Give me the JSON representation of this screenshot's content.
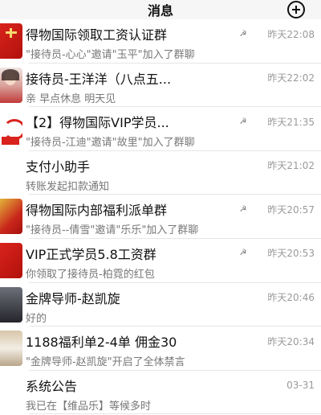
{
  "header": {
    "title": "消息",
    "add_icon": "plus-circle-icon"
  },
  "mute_glyph": "☭",
  "chats": [
    {
      "name": "得物国际领取工资认证群",
      "preview": "\"接待员-心心\"邀请\"玉平\"加入了群聊",
      "time": "昨天22:08",
      "muted": true,
      "avatar": "av-red av-cross"
    },
    {
      "name": "接待员-王洋洋（八点五...",
      "preview": "亲 早点休息  明天见",
      "time": "昨天22:02",
      "muted": false,
      "avatar": "av-person av-face"
    },
    {
      "name": "【2】得物国际VIP学员...",
      "preview": "\"接待员-江迪\"邀请\"故里\"加入了群聊",
      "time": "昨天21:35",
      "muted": true,
      "avatar": "av-white av-logo"
    },
    {
      "name": "支付小助手",
      "preview": "转账发起扣款通知",
      "time": "昨天21:02",
      "muted": false,
      "avatar": "blank"
    },
    {
      "name": "得物国际内部福利派单群",
      "preview": "\"接待员--倩雪\"邀请\"乐乐\"加入了群聊",
      "time": "昨天20:57",
      "muted": true,
      "avatar": "av-gold"
    },
    {
      "name": "VIP正式学员5.8工资群",
      "preview": "你领取了接待员-柏霓的红包",
      "time": "昨天20:53",
      "muted": true,
      "avatar": "av-red"
    },
    {
      "name": "金牌导师-赵凯旋",
      "preview": "好的",
      "time": "昨天20:46",
      "muted": false,
      "avatar": "av-dark"
    },
    {
      "name": "1188福利单2-4单 佣金30",
      "preview": "\"金牌导师-赵凯旋\"开启了全体禁言",
      "time": "昨天20:34",
      "muted": false,
      "avatar": "av-mix"
    },
    {
      "name": "系统公告",
      "preview": "我已在【维品乐】等候多时",
      "time": "03-31",
      "muted": false,
      "avatar": "blank"
    }
  ]
}
